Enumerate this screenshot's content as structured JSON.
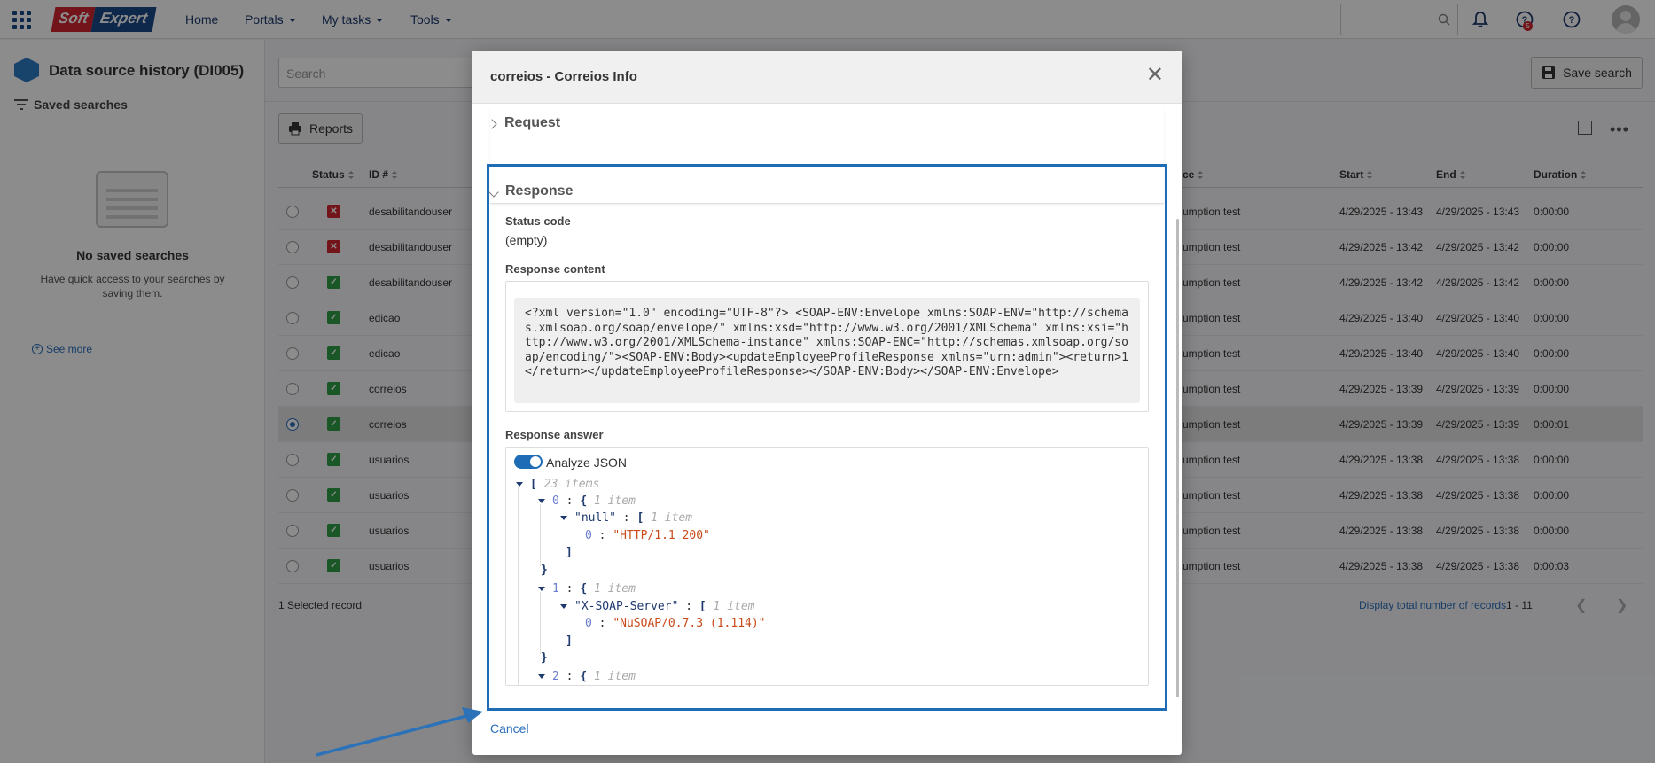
{
  "topbar": {
    "brand_soft": "Soft",
    "brand_expert": "Expert",
    "nav": {
      "home": "Home",
      "portals": "Portals",
      "my_tasks": "My tasks",
      "tools": "Tools"
    },
    "notif_count": "5"
  },
  "sidebar": {
    "title": "Data source history (DI005)",
    "saved_searches": "Saved searches",
    "empty_title": "No saved searches",
    "empty_text": "Have quick access to your searches by saving them.",
    "see_more": "See more"
  },
  "main": {
    "search_placeholder": "Search",
    "save_search": "Save search",
    "reports": "Reports",
    "columns": {
      "status": "Status",
      "id": "ID #",
      "source": "ce",
      "start": "Start",
      "end": "End",
      "duration": "Duration"
    },
    "rows": [
      {
        "status": "error",
        "id": "desabilitandouser",
        "source": "umption test",
        "start": "4/29/2025 - 13:43",
        "end": "4/29/2025 - 13:43",
        "duration": "0:00:00",
        "selected": false
      },
      {
        "status": "error",
        "id": "desabilitandouser",
        "source": "umption test",
        "start": "4/29/2025 - 13:42",
        "end": "4/29/2025 - 13:42",
        "duration": "0:00:00",
        "selected": false
      },
      {
        "status": "ok",
        "id": "desabilitandouser",
        "source": "umption test",
        "start": "4/29/2025 - 13:42",
        "end": "4/29/2025 - 13:42",
        "duration": "0:00:00",
        "selected": false
      },
      {
        "status": "ok",
        "id": "edicao",
        "source": "umption test",
        "start": "4/29/2025 - 13:40",
        "end": "4/29/2025 - 13:40",
        "duration": "0:00:00",
        "selected": false
      },
      {
        "status": "ok",
        "id": "edicao",
        "source": "umption test",
        "start": "4/29/2025 - 13:40",
        "end": "4/29/2025 - 13:40",
        "duration": "0:00:00",
        "selected": false
      },
      {
        "status": "ok",
        "id": "correios",
        "source": "umption test",
        "start": "4/29/2025 - 13:39",
        "end": "4/29/2025 - 13:39",
        "duration": "0:00:00",
        "selected": false
      },
      {
        "status": "ok",
        "id": "correios",
        "source": "umption test",
        "start": "4/29/2025 - 13:39",
        "end": "4/29/2025 - 13:39",
        "duration": "0:00:01",
        "selected": true
      },
      {
        "status": "ok",
        "id": "usuarios",
        "source": "umption test",
        "start": "4/29/2025 - 13:38",
        "end": "4/29/2025 - 13:38",
        "duration": "0:00:00",
        "selected": false
      },
      {
        "status": "ok",
        "id": "usuarios",
        "source": "umption test",
        "start": "4/29/2025 - 13:38",
        "end": "4/29/2025 - 13:38",
        "duration": "0:00:00",
        "selected": false
      },
      {
        "status": "ok",
        "id": "usuarios",
        "source": "umption test",
        "start": "4/29/2025 - 13:38",
        "end": "4/29/2025 - 13:38",
        "duration": "0:00:00",
        "selected": false
      },
      {
        "status": "ok",
        "id": "usuarios",
        "source": "umption test",
        "start": "4/29/2025 - 13:38",
        "end": "4/29/2025 - 13:38",
        "duration": "0:00:03",
        "selected": false
      }
    ],
    "selected_count": "1 Selected record",
    "display_total": "Display total number of records",
    "range": "1 - 11"
  },
  "modal": {
    "title": "correios - Correios Info",
    "request_label": "Request",
    "response_label": "Response",
    "status_code_label": "Status code",
    "status_code_value": "(empty)",
    "response_content_label": "Response content",
    "response_content": "<?xml version=\"1.0\" encoding=\"UTF-8\"?> <SOAP-ENV:Envelope xmlns:SOAP-ENV=\"http://schemas.xmlsoap.org/soap/envelope/\" xmlns:xsd=\"http://www.w3.org/2001/XMLSchema\" xmlns:xsi=\"http://www.w3.org/2001/XMLSchema-instance\" xmlns:SOAP-ENC=\"http://schemas.xmlsoap.org/soap/encoding/\"><SOAP-ENV:Body><updateEmployeeProfileResponse xmlns=\"urn:admin\"><return>1</return></updateEmployeeProfileResponse></SOAP-ENV:Body></SOAP-ENV:Envelope>",
    "response_answer_label": "Response answer",
    "analyze_json_label": "Analyze JSON",
    "json": {
      "root_open": "[",
      "root_count": "23 items",
      "items": [
        {
          "idx": "0",
          "count": "1 item",
          "key": "\"null\"",
          "key_count": "1 item",
          "sub_idx": "0",
          "value": "\"HTTP/1.1 200\""
        },
        {
          "idx": "1",
          "count": "1 item",
          "key": "\"X-SOAP-Server\"",
          "key_count": "1 item",
          "sub_idx": "0",
          "value": "\"NuSOAP/0.7.3 (1.114)\""
        },
        {
          "idx": "2",
          "count": "1 item"
        }
      ]
    },
    "cancel": "Cancel"
  }
}
